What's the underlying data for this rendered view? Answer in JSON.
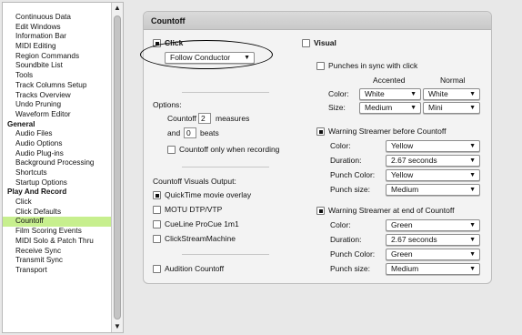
{
  "sidebar": {
    "items": [
      {
        "label": "Continuous Data",
        "type": "item"
      },
      {
        "label": "Edit Windows",
        "type": "item"
      },
      {
        "label": "Information Bar",
        "type": "item"
      },
      {
        "label": "MIDI Editing",
        "type": "item"
      },
      {
        "label": "Region Commands",
        "type": "item"
      },
      {
        "label": "Soundbite List",
        "type": "item"
      },
      {
        "label": "Tools",
        "type": "item"
      },
      {
        "label": "Track Columns Setup",
        "type": "item"
      },
      {
        "label": "Tracks Overview",
        "type": "item"
      },
      {
        "label": "Undo Pruning",
        "type": "item"
      },
      {
        "label": "Waveform Editor",
        "type": "item"
      },
      {
        "label": "General",
        "type": "group"
      },
      {
        "label": "Audio Files",
        "type": "item"
      },
      {
        "label": "Audio Options",
        "type": "item"
      },
      {
        "label": "Audio Plug-ins",
        "type": "item"
      },
      {
        "label": "Background Processing",
        "type": "item"
      },
      {
        "label": "Shortcuts",
        "type": "item"
      },
      {
        "label": "Startup Options",
        "type": "item"
      },
      {
        "label": "Play And Record",
        "type": "group"
      },
      {
        "label": "Click",
        "type": "item"
      },
      {
        "label": "Click Defaults",
        "type": "item"
      },
      {
        "label": "Countoff",
        "type": "item",
        "selected": true
      },
      {
        "label": "Film Scoring Events",
        "type": "item"
      },
      {
        "label": "MIDI Solo & Patch Thru",
        "type": "item"
      },
      {
        "label": "Receive Sync",
        "type": "item"
      },
      {
        "label": "Transmit Sync",
        "type": "item"
      },
      {
        "label": "Transport",
        "type": "item"
      }
    ],
    "scroll_up_glyph": "▲",
    "scroll_down_glyph": "▼"
  },
  "panel": {
    "title": "Countoff",
    "click": {
      "label": "Click",
      "checked": true,
      "popup_value": "Follow Conductor"
    },
    "options": {
      "label": "Options:",
      "countoff_prefix": "Countoff",
      "countoff_value": "2",
      "countoff_suffix": "measures",
      "and_prefix": "and",
      "beats_value": "0",
      "beats_suffix": "beats",
      "only_recording_label": "Countoff only when recording",
      "only_recording_checked": false
    },
    "visuals_output": {
      "label": "Countoff Visuals Output:",
      "items": [
        {
          "label": "QuickTime movie overlay",
          "checked": true
        },
        {
          "label": "MOTU DTP/VTP",
          "checked": false
        },
        {
          "label": "CueLine ProCue 1m1",
          "checked": false
        },
        {
          "label": "ClickStreamMachine",
          "checked": false
        }
      ]
    },
    "audition": {
      "label": "Audition Countoff",
      "checked": false
    },
    "visual": {
      "label": "Visual",
      "checked": false,
      "punches_label": "Punches in sync with click",
      "punches_checked": false,
      "accented_header": "Accented",
      "normal_header": "Normal",
      "color_label": "Color:",
      "color_accented": "White",
      "color_normal": "White",
      "size_label": "Size:",
      "size_accented": "Medium",
      "size_normal": "Mini"
    },
    "streamer_before": {
      "label": "Warning Streamer before Countoff",
      "checked": true,
      "color_label": "Color:",
      "color_value": "Yellow",
      "duration_label": "Duration:",
      "duration_value": "2.67 seconds",
      "punch_color_label": "Punch Color:",
      "punch_color_value": "Yellow",
      "punch_size_label": "Punch size:",
      "punch_size_value": "Medium"
    },
    "streamer_end": {
      "label": "Warning Streamer at end of Countoff",
      "checked": true,
      "color_label": "Color:",
      "color_value": "Green",
      "duration_label": "Duration:",
      "duration_value": "2.67 seconds",
      "punch_color_label": "Punch Color:",
      "punch_color_value": "Green",
      "punch_size_label": "Punch size:",
      "punch_size_value": "Medium"
    },
    "popup_arrow_glyph": "▼"
  },
  "colors": {
    "selection": "#c7ef8e",
    "panel_bg": "#f3f3f3",
    "window_bg": "#e8e8e8"
  }
}
